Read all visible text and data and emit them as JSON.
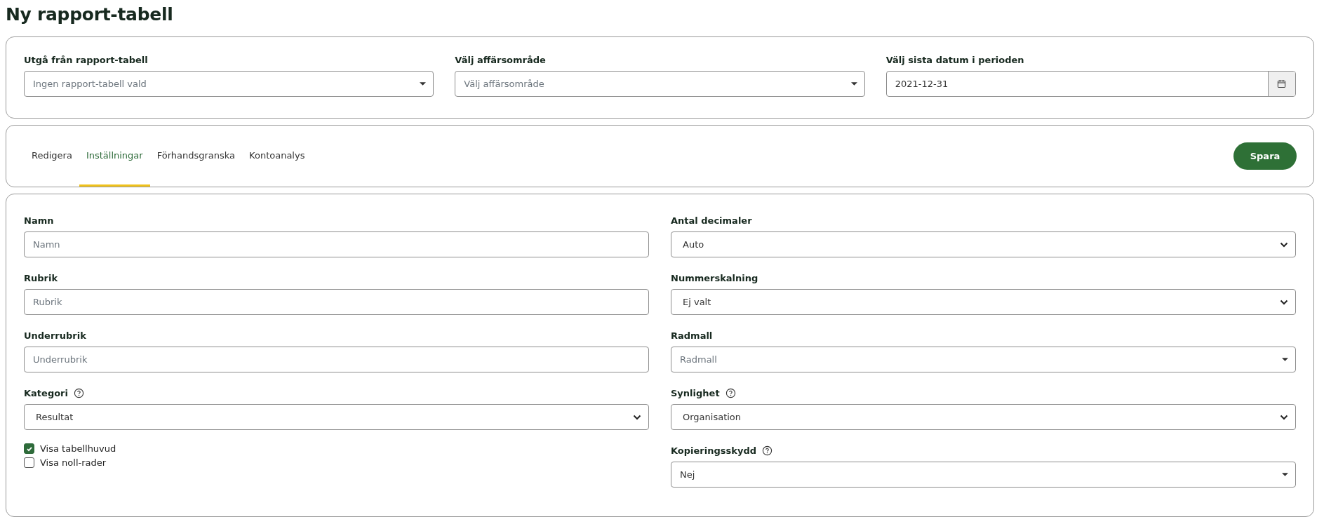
{
  "page_title": "Ny rapport-tabell",
  "filters": [
    {
      "label": "Utgå från rapport-tabell",
      "help": false,
      "kind": "caret",
      "placeholder": "Ingen rapport-tabell vald"
    },
    {
      "label": "Välj affärsområde",
      "help": false,
      "kind": "caret",
      "placeholder": "Välj affärsområde"
    },
    {
      "label": "Välj sista datum i perioden",
      "help": false,
      "kind": "date",
      "value": "2021-12-31"
    }
  ],
  "tabs": [
    {
      "label": "Redigera",
      "selected": false
    },
    {
      "label": "Inställningar",
      "selected": true
    },
    {
      "label": "Förhandsgranska",
      "selected": false
    },
    {
      "label": "Kontoanalys",
      "selected": false
    }
  ],
  "save_button": "Spara",
  "left_fields": [
    {
      "label": "Namn",
      "help": false,
      "kind": "text",
      "placeholder": "Namn"
    },
    {
      "label": "Rubrik",
      "help": false,
      "kind": "text",
      "placeholder": "Rubrik"
    },
    {
      "label": "Underrubrik",
      "help": false,
      "kind": "text",
      "placeholder": "Underrubrik"
    },
    {
      "label": "Kategori",
      "help": true,
      "kind": "chevron",
      "value": "Resultat"
    }
  ],
  "checkboxes": [
    {
      "label": "Visa tabellhuvud",
      "checked": true
    },
    {
      "label": "Visa noll-rader",
      "checked": false
    }
  ],
  "right_fields": [
    {
      "label": "Antal decimaler",
      "help": false,
      "kind": "chevron",
      "value": "Auto"
    },
    {
      "label": "Nummerskalning",
      "help": false,
      "kind": "chevron",
      "value": "Ej valt"
    },
    {
      "label": "Radmall",
      "help": false,
      "kind": "caret",
      "placeholder": "Radmall"
    },
    {
      "label": "Synlighet",
      "help": true,
      "kind": "chevron",
      "value": "Organisation"
    },
    {
      "label": "Kopieringsskydd",
      "help": true,
      "kind": "caret",
      "value": "Nej"
    }
  ]
}
